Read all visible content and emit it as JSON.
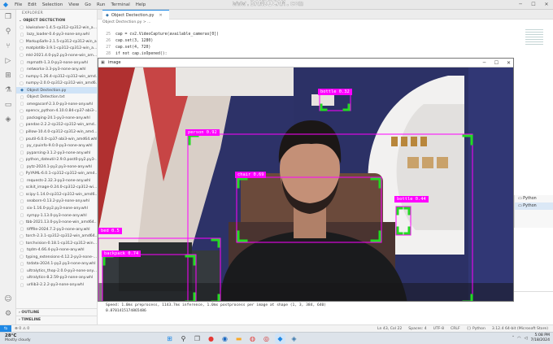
{
  "menu": [
    "File",
    "Edit",
    "Selection",
    "View",
    "Go",
    "Run",
    "Terminal",
    "Help"
  ],
  "watermark": "www.BANDICAM.com",
  "sidebar": {
    "title": "EXPLORER",
    "section": "OBJECT DECTECTION",
    "files": [
      "kiwisolver-1.4.5-cp312-cp312-win_a...",
      "lazy_loader-0.4-py3-none-any.whl",
      "MarkupSafe-2.1.5-cp312-cp312-win_a...",
      "matplotlib-3.9.1-cp312-cp312-win_a...",
      "mkl-2021.4.0-py2.py3-none-win_am...",
      "mpmath-1.3.0-py3-none-any.whl",
      "networkx-3.3-py3-none-any.whl",
      "numpy-1.26.4-cp312-cp312-win_amd...",
      "numpy-2.0.0-cp312-cp312-win_amd6...",
      "Object Dectection.py",
      "Object Detection.txt",
      "omegaconf-2.3.0-py3-none-any.whl",
      "opencv_python-4.10.0.84-cp37-abi3-...",
      "packaging-24.1-py3-none-any.whl",
      "pandas-2.2.2-cp312-cp312-win_amd...",
      "pillow-10.4.0-cp312-cp312-win_amd...",
      "psutil-6.0.0-cp37-abi3-win_amd64.whl",
      "py_cpuinfo-9.0.0-py3-none-any.whl",
      "pyparsing-3.1.2-py3-none-any.whl",
      "python_dateutil-2.9.0.post0-py2.py3-...",
      "pytz-2024.1-py2.py3-none-any.whl",
      "PyYAML-6.0.1-cp312-cp312-win_amd...",
      "requests-2.32.3-py3-none-any.whl",
      "scikit_image-0.24.0-cp312-cp312-wi...",
      "scipy-1.14.0-cp312-cp312-win_amd6...",
      "seaborn-0.13.2-py3-none-any.whl",
      "six-1.16.0-py2.py3-none-any.whl",
      "sympy-1.13.0-py3-none-any.whl",
      "tbb-2021.13.0-py3-none-win_amd64...",
      "tifffile-2024.7.2-py3-none-any.whl",
      "torch-2.3.1-cp312-cp312-win_amd64...",
      "torchvision-0.18.1-cp312-cp312-win...",
      "tqdm-4.66.4-py3-none-any.whl",
      "typing_extensions-4.12.2-py3-none-...",
      "tzdata-2024.1-py2.py3-none-any.whl",
      "ultralytics_thop-2.0.0-py3-none-any...",
      "ultralytics-8.2.59-py3-none-any.whl",
      "urllib3-2.2.2-py3-none-any.whl"
    ],
    "outline": "OUTLINE",
    "timeline": "TIMELINE"
  },
  "tab": {
    "label": "Object Dectection.py"
  },
  "breadcrumb": "Object Dectection.py > ...",
  "code": [
    {
      "n": "25",
      "t": "cap = cv2.VideoCapture(available_cameras[0])"
    },
    {
      "n": "26",
      "t": "cap.set(3, 1280)"
    },
    {
      "n": "27",
      "t": "cap.set(4, 720)"
    },
    {
      "n": "28",
      "t": "if not cap.isOpened():"
    }
  ],
  "right_panel": [
    "Python",
    "Python"
  ],
  "terminal": [
    "Speed: 1.0ms preprocess, 1143.7ms inference, 1.0ms postprocess per image at shape (1, 3, 384, 640)",
    "0.8701415174865486"
  ],
  "statusbar": {
    "left": "⊗ 0 ⚠ 0",
    "right": [
      "Ln 43, Col 22",
      "Spaces: 4",
      "UTF-8",
      "CRLF",
      "{} Python",
      "3.12.4 64-bit (Microsoft Store)"
    ]
  },
  "image_window": {
    "title": "image",
    "detections": [
      {
        "label": "bottle 0.32",
        "color": "#ff00ff"
      },
      {
        "label": "person 0.92",
        "color": "#ff00ff"
      },
      {
        "label": "chair 0.69",
        "color": "#ff00ff"
      },
      {
        "label": "bottle 0.44",
        "color": "#ff00ff"
      },
      {
        "label": "bed 0.5",
        "color": "#ff00ff"
      },
      {
        "label": "backpack 0.74",
        "color": "#ff00ff"
      }
    ]
  },
  "taskbar": {
    "temperature": "28°C",
    "condition": "Mostly cloudy",
    "time": "5:08 PM",
    "date": "7/18/2024"
  },
  "colors": {
    "accent": "#1e88e5",
    "detection_label": "#ff00ff",
    "box_corner": "#22dd22"
  }
}
